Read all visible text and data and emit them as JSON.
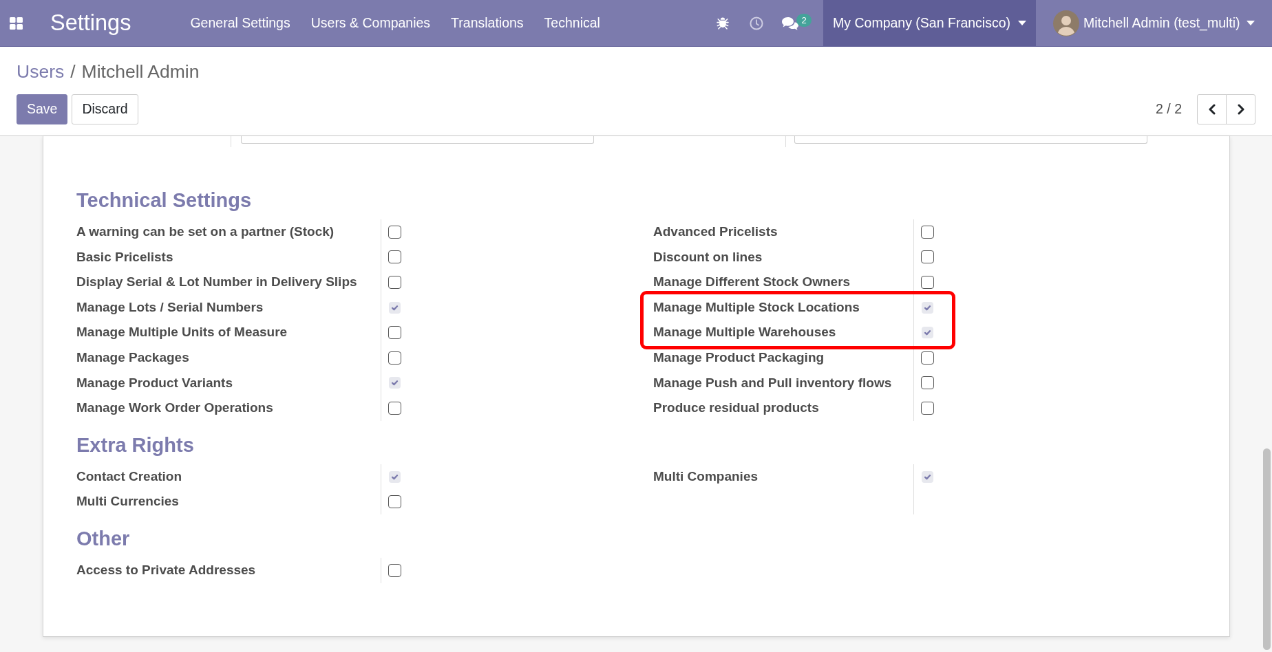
{
  "navbar": {
    "app_title": "Settings",
    "menu": [
      {
        "label": "General Settings"
      },
      {
        "label": "Users & Companies"
      },
      {
        "label": "Translations"
      },
      {
        "label": "Technical"
      }
    ],
    "systray": [
      {
        "kind": "debug"
      },
      {
        "kind": "activity"
      },
      {
        "kind": "messages",
        "badge": "2"
      }
    ],
    "company": {
      "label": "My Company (San Francisco)"
    },
    "user": {
      "label": "Mitchell Admin (test_multi)"
    }
  },
  "control_panel": {
    "breadcrumb": {
      "parent": "Users",
      "separator": "/",
      "current": "Mitchell Admin"
    },
    "buttons": [
      {
        "label": "Save",
        "kind": "primary"
      },
      {
        "label": "Discard",
        "kind": "secondary"
      }
    ],
    "pager": {
      "counter": "2 / 2",
      "buttons": [
        {
          "kind": "previous"
        },
        {
          "kind": "next"
        }
      ]
    }
  },
  "form": {
    "partially_hidden_fields": [
      {
        "kind": "input"
      },
      {
        "kind": "input"
      }
    ],
    "sections": [
      {
        "title": "Technical Settings",
        "left": [
          {
            "label": "A warning can be set on a partner (Stock)",
            "checked": false,
            "highlighted": false
          },
          {
            "label": "Basic Pricelists",
            "checked": false,
            "highlighted": false
          },
          {
            "label": "Display Serial & Lot Number in Delivery Slips",
            "checked": false,
            "highlighted": false
          },
          {
            "label": "Manage Lots / Serial Numbers",
            "checked": true,
            "highlighted": false
          },
          {
            "label": "Manage Multiple Units of Measure",
            "checked": false,
            "highlighted": false
          },
          {
            "label": "Manage Packages",
            "checked": false,
            "highlighted": false
          },
          {
            "label": "Manage Product Variants",
            "checked": true,
            "highlighted": false
          },
          {
            "label": "Manage Work Order Operations",
            "checked": false,
            "highlighted": false
          }
        ],
        "right": [
          {
            "label": "Advanced Pricelists",
            "checked": false,
            "highlighted": false
          },
          {
            "label": "Discount on lines",
            "checked": false,
            "highlighted": false
          },
          {
            "label": "Manage Different Stock Owners",
            "checked": false,
            "highlighted": false
          },
          {
            "label": "Manage Multiple Stock Locations",
            "checked": true,
            "highlighted": true
          },
          {
            "label": "Manage Multiple Warehouses",
            "checked": true,
            "highlighted": true
          },
          {
            "label": "Manage Product Packaging",
            "checked": false,
            "highlighted": false
          },
          {
            "label": "Manage Push and Pull inventory flows",
            "checked": false,
            "highlighted": false
          },
          {
            "label": "Produce residual products",
            "checked": false,
            "highlighted": false
          }
        ]
      },
      {
        "title": "Extra Rights",
        "left": [
          {
            "label": "Contact Creation",
            "checked": true,
            "highlighted": false
          },
          {
            "label": "Multi Currencies",
            "checked": false,
            "highlighted": false
          }
        ],
        "right": [
          {
            "label": "Multi Companies",
            "checked": true,
            "highlighted": false
          }
        ]
      },
      {
        "title": "Other",
        "left": [
          {
            "label": "Access to Private Addresses",
            "checked": false,
            "highlighted": false
          }
        ]
      }
    ]
  }
}
